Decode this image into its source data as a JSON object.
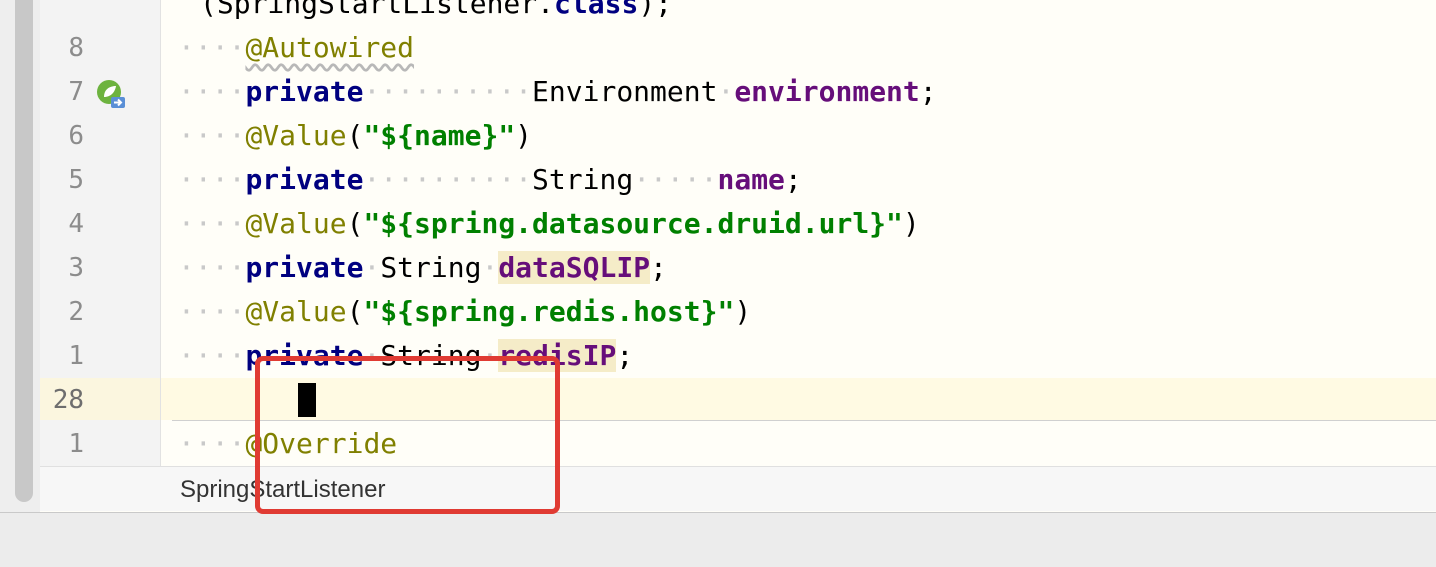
{
  "colors": {
    "annotation": "#808000",
    "keyword": "#000080",
    "string": "#008000",
    "field": "#660e7a",
    "highlight_box": "#e03b33"
  },
  "icons": {
    "gutter_run": "spring-bean-run-icon"
  },
  "editor": {
    "top_partial": {
      "prefix": "(SpringStartListener.",
      "keyword": "class",
      "suffix": ");"
    },
    "lines": [
      {
        "num": "8",
        "annotation": "@Autowired"
      },
      {
        "num": "7",
        "keyword": "private",
        "type": "Environment",
        "field": "environment",
        "end": ";"
      },
      {
        "num": "6",
        "annotation": "@Value",
        "open": "(",
        "string": "\"${name}\"",
        "close": ")"
      },
      {
        "num": "5",
        "keyword": "private",
        "type": "String",
        "field": "name",
        "end": ";"
      },
      {
        "num": "4",
        "annotation": "@Value",
        "open": "(",
        "string": "\"${spring.datasource.druid.url}\"",
        "close": ")"
      },
      {
        "num": "3",
        "keyword": "private",
        "type": "String",
        "field": "dataSQLIP",
        "end": ";"
      },
      {
        "num": "2",
        "annotation": "@Value",
        "open": "(",
        "string": "\"${spring.redis.host}\"",
        "close": ")"
      },
      {
        "num": "1",
        "keyword": "private",
        "type": "String",
        "field": "redisIP",
        "end": ";"
      },
      {
        "num": "28"
      },
      {
        "num": "1",
        "annotation": "@Override"
      }
    ]
  },
  "breadcrumb": "SpringStartListener"
}
